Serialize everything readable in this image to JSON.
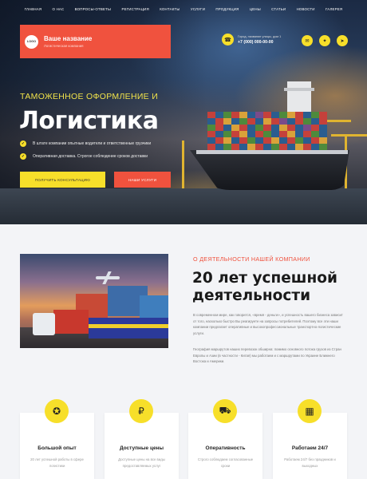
{
  "nav": [
    "Главная",
    "О нас",
    "Вопросы-ответы",
    "Регистрация",
    "Контакты",
    "Услуги",
    "Продукция",
    "Цены",
    "Статьи",
    "Новости",
    "Галерея"
  ],
  "brand": {
    "logo": "LOGO",
    "name": "Ваше название",
    "tagline": "Логистическая компания"
  },
  "contact": {
    "address": "Город, название улицы, дом 1",
    "phone": "+7 (000) 000-00-00"
  },
  "hero": {
    "kicker": "Таможенное оформление и",
    "title": "Логистика",
    "bullets": [
      "В штате компании опытные водители и ответственные грузчики",
      "Оперативная доставка. Строгое соблюдение сроков доставки"
    ],
    "cta_primary": "Получить консультацию",
    "cta_secondary": "Наши услуги"
  },
  "about": {
    "kicker": "О деятельности нашей компании",
    "title": "20 лет успешной деятельности",
    "paragraphs": [
      "В современном мире, как говорится, «время - деньги», и успешность вашего бизнеса зависит от того, насколько быстро Вы реагируете на запросы потребителей. Поэтому все эти наши компании предлагает оперативные и высокопрофессиональные транспортно-логистические услуги.",
      "География маршрутов наших перевозок обширна: помимо основного потока грузов из Стран Европы и Азии (в частности - Китая) мы работаем и с маршрутами по Украине Ближнего Востока и Америки."
    ]
  },
  "features": [
    {
      "icon": "award-icon",
      "title": "Большой опыт",
      "text": "20 лет успешной работы в сфере логистики"
    },
    {
      "icon": "price-icon",
      "title": "Доступные цены",
      "text": "Доступные цены на все виды предоставляемых услуг"
    },
    {
      "icon": "truck-icon",
      "title": "Оперативность",
      "text": "Строго соблюдаем согласованные сроки"
    },
    {
      "icon": "calendar-icon",
      "title": "Работаем 24/7",
      "text": "Работаем 24/7 без праздников и выходных"
    }
  ],
  "colors": {
    "accent_yellow": "#f7df2a",
    "accent_red": "#f0523e"
  }
}
